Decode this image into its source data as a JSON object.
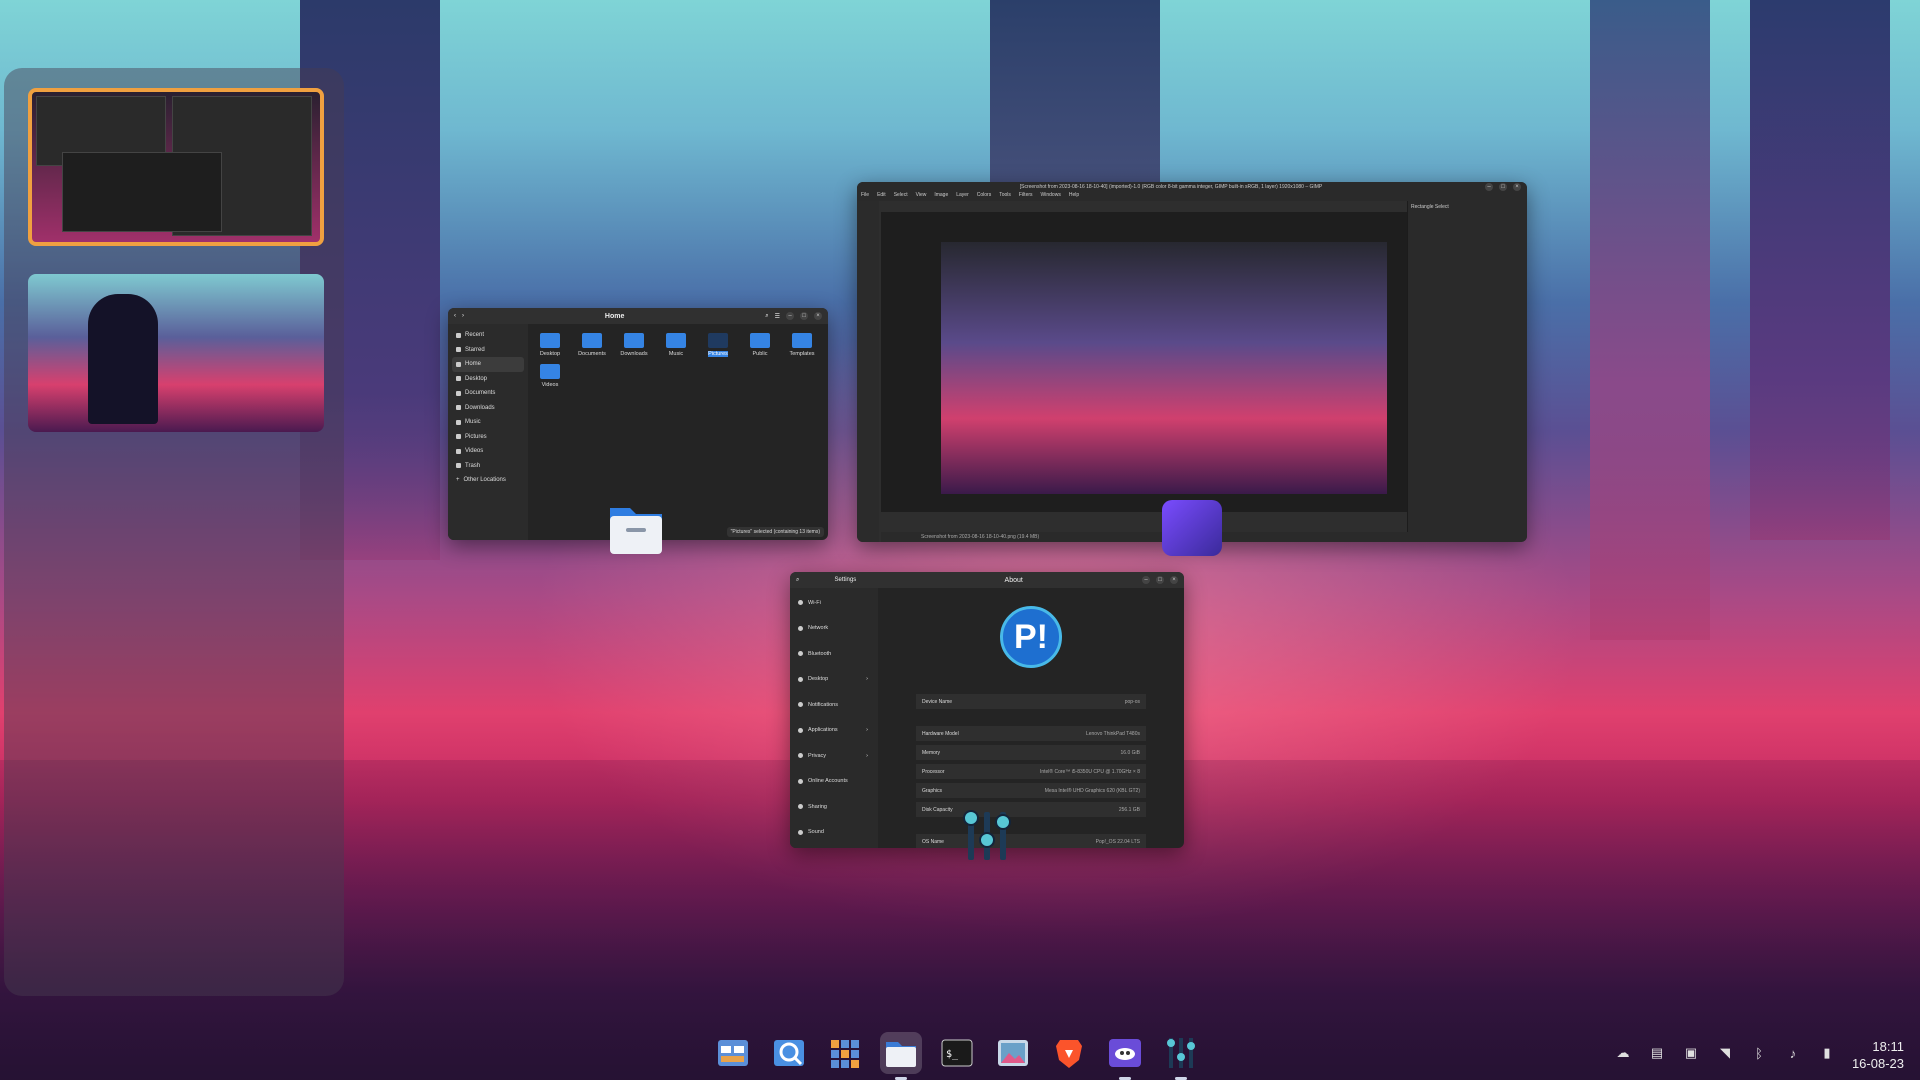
{
  "workspaces": {
    "items": [
      {
        "label": "Workspace 1",
        "active": true
      },
      {
        "label": "Workspace 2",
        "active": false
      }
    ]
  },
  "files_window": {
    "title": "Home",
    "sidebar": [
      "Recent",
      "Starred",
      "Home",
      "Desktop",
      "Documents",
      "Downloads",
      "Music",
      "Pictures",
      "Videos",
      "Trash",
      "Other Locations"
    ],
    "selected_sidebar": "Home",
    "folders": [
      "Desktop",
      "Documents",
      "Downloads",
      "Music",
      "Pictures",
      "Public",
      "Templates",
      "Videos"
    ],
    "selected_folder": "Pictures",
    "status": "\"Pictures\" selected (containing 13 items)"
  },
  "gimp_window": {
    "title": "[Screenshot from 2023-08-16 18-10-40] (imported)-1.0 (RGB color 8-bit gamma integer, GIMP built-in sRGB, 1 layer) 1920x1080 – GIMP",
    "menu": [
      "File",
      "Edit",
      "Select",
      "View",
      "Image",
      "Layer",
      "Colors",
      "Tools",
      "Filters",
      "Windows",
      "Help"
    ],
    "status": "Screenshot from 2023-08-16 18-10-40.png (19.4 MB)",
    "dock_title": "Rectangle Select"
  },
  "settings_window": {
    "title": "Settings",
    "page_title": "About",
    "sidebar": [
      {
        "label": "Wi-Fi",
        "arrow": ""
      },
      {
        "label": "Network",
        "arrow": ""
      },
      {
        "label": "Bluetooth",
        "arrow": ""
      },
      {
        "label": "Desktop",
        "arrow": "›"
      },
      {
        "label": "Notifications",
        "arrow": ""
      },
      {
        "label": "Applications",
        "arrow": "›"
      },
      {
        "label": "Privacy",
        "arrow": "›"
      },
      {
        "label": "Online Accounts",
        "arrow": ""
      },
      {
        "label": "Sharing",
        "arrow": ""
      },
      {
        "label": "Sound",
        "arrow": ""
      }
    ],
    "device_name_label": "Device Name",
    "device_name_value": "pop-os",
    "rows": [
      {
        "label": "Hardware Model",
        "value": "Lenovo ThinkPad T480s"
      },
      {
        "label": "Memory",
        "value": "16.0 GiB"
      },
      {
        "label": "Processor",
        "value": "Intel® Core™ i5-8350U CPU @ 1.70GHz × 8"
      },
      {
        "label": "Graphics",
        "value": "Mesa Intel® UHD Graphics 620 (KBL GT2)"
      },
      {
        "label": "Disk Capacity",
        "value": "256.1 GB"
      }
    ],
    "os_label": "OS Name",
    "os_value": "Pop!_OS 22.04 LTS"
  },
  "dock": {
    "apps": [
      {
        "name": "app-library",
        "color": "#5b8fd8",
        "running": false,
        "focused": false
      },
      {
        "name": "launcher",
        "color": "#4a90e2",
        "running": false,
        "focused": false
      },
      {
        "name": "workspaces",
        "color": "#f0a040",
        "running": false,
        "focused": false
      },
      {
        "name": "files",
        "color": "#3a7bd5",
        "running": true,
        "focused": true
      },
      {
        "name": "terminal",
        "color": "#1a1a1a",
        "running": false,
        "focused": false
      },
      {
        "name": "image-viewer",
        "color": "#c8d8e8",
        "running": false,
        "focused": false
      },
      {
        "name": "brave",
        "color": "#fb542b",
        "running": false,
        "focused": false
      },
      {
        "name": "gimp",
        "color": "#6a4cd8",
        "running": true,
        "focused": false
      },
      {
        "name": "mixer",
        "color": "#1a2a3a",
        "running": true,
        "focused": false
      }
    ]
  },
  "tray": {
    "icons": [
      "cloud-icon",
      "clipboard-icon",
      "display-icon",
      "wifi-icon",
      "bluetooth-icon",
      "volume-icon",
      "battery-icon"
    ]
  },
  "clock": {
    "time": "18:11",
    "date": "16-08-23"
  }
}
